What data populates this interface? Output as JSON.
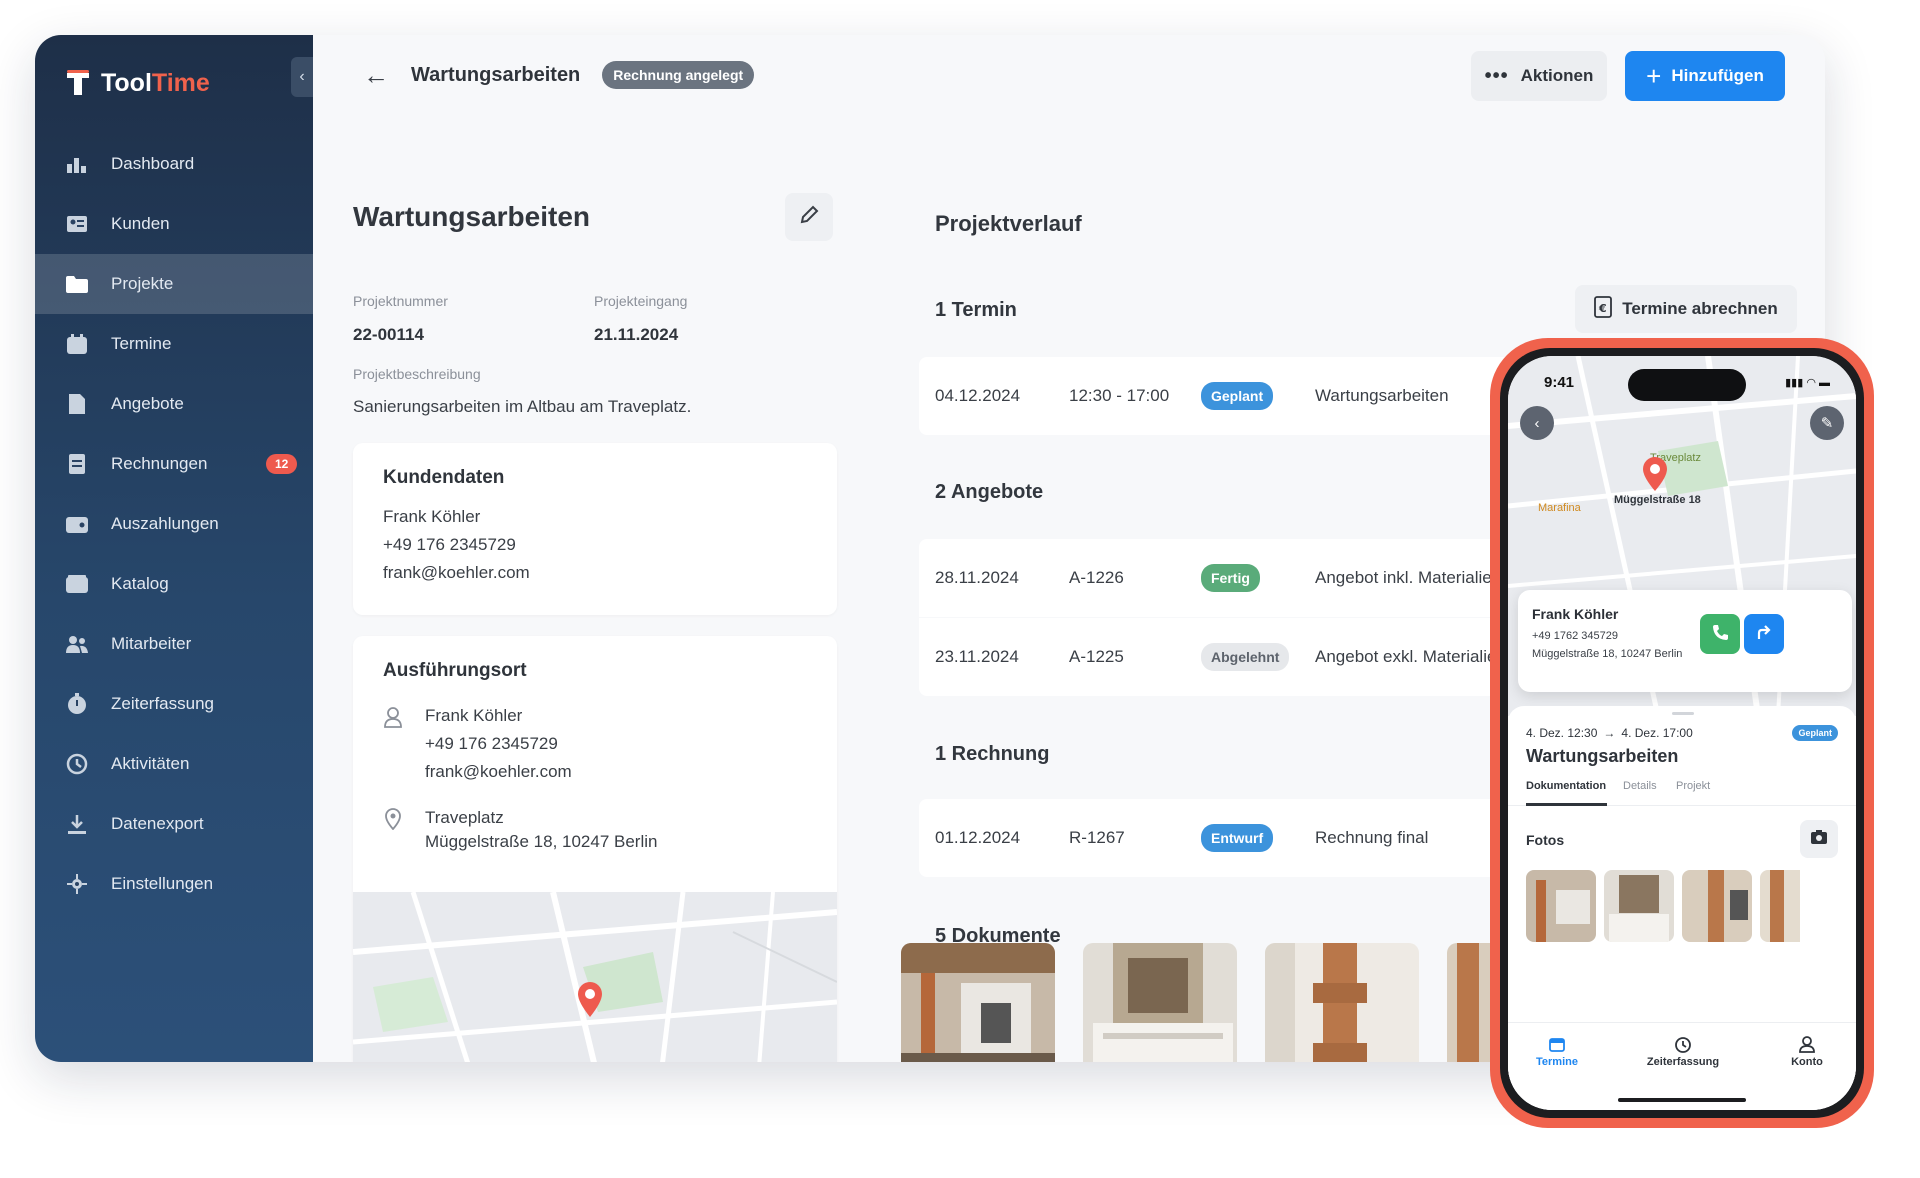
{
  "brand": {
    "name_part1": "Tool",
    "name_part2": "Time",
    "accent_color": "#f0624c"
  },
  "sidebar": {
    "items": [
      {
        "label": "Dashboard",
        "icon": "dashboard-icon"
      },
      {
        "label": "Kunden",
        "icon": "customers-icon"
      },
      {
        "label": "Projekte",
        "icon": "folder-icon",
        "active": true
      },
      {
        "label": "Termine",
        "icon": "calendar-icon"
      },
      {
        "label": "Angebote",
        "icon": "document-icon"
      },
      {
        "label": "Rechnungen",
        "icon": "invoice-icon",
        "badge": "12"
      },
      {
        "label": "Auszahlungen",
        "icon": "wallet-icon"
      },
      {
        "label": "Katalog",
        "icon": "catalog-icon"
      },
      {
        "label": "Mitarbeiter",
        "icon": "employees-icon"
      },
      {
        "label": "Zeiterfassung",
        "icon": "stopwatch-icon"
      },
      {
        "label": "Aktivitäten",
        "icon": "history-icon"
      },
      {
        "label": "Datenexport",
        "icon": "download-icon"
      },
      {
        "label": "Einstellungen",
        "icon": "settings-icon"
      }
    ]
  },
  "topbar": {
    "title": "Wartungsarbeiten",
    "status": "Rechnung angelegt",
    "actions_label": "Aktionen",
    "add_label": "Hinzufügen"
  },
  "project": {
    "title": "Wartungsarbeiten",
    "number_label": "Projektnummer",
    "number": "22-00114",
    "received_label": "Projekteingang",
    "received": "21.11.2024",
    "description_label": "Projektbeschreibung",
    "description": "Sanierungsarbeiten im Altbau am Traveplatz."
  },
  "customer": {
    "heading": "Kundendaten",
    "name": "Frank Köhler",
    "phone": "+49 176 2345729",
    "email": "frank@koehler.com"
  },
  "location": {
    "heading": "Ausführungsort",
    "name": "Frank Köhler",
    "phone": "+49 176 2345729",
    "email": "frank@koehler.com",
    "place": "Traveplatz",
    "address": "Müggelstraße 18, 10247 Berlin"
  },
  "history": {
    "heading": "Projektverlauf",
    "appointments_heading": "1 Termin",
    "bill_button": "Termine abrechnen",
    "appointments": [
      {
        "date": "04.12.2024",
        "time": "12:30 - 17:00",
        "status": "Geplant",
        "title": "Wartungsarbeiten"
      }
    ],
    "offers_heading": "2 Angebote",
    "offers": [
      {
        "date": "28.11.2024",
        "number": "A-1226",
        "status": "Fertig",
        "title": "Angebot inkl. Materialien"
      },
      {
        "date": "23.11.2024",
        "number": "A-1225",
        "status": "Abgelehnt",
        "title": "Angebot exkl. Materialien"
      }
    ],
    "invoices_heading": "1 Rechnung",
    "invoices": [
      {
        "date": "01.12.2024",
        "number": "R-1267",
        "status": "Entwurf",
        "title": "Rechnung final"
      }
    ],
    "documents_heading": "5 Dokumente"
  },
  "phone": {
    "time": "9:41",
    "map_labels": {
      "place": "Traveplatz",
      "street": "Müggelstraße 18",
      "poi": "Marafina"
    },
    "contact_name": "Frank Köhler",
    "contact_phone": "+49 1762 345729",
    "contact_address": "Müggelstraße 18, 10247 Berlin",
    "range_start": "4. Dez. 12:30",
    "range_arrow": "→",
    "range_end": "4. Dez. 17:00",
    "status": "Geplant",
    "title": "Wartungsarbeiten",
    "tabs": [
      "Dokumentation",
      "Details",
      "Projekt"
    ],
    "photos_heading": "Fotos",
    "tabbar": [
      "Termine",
      "Zeiterfassung",
      "Konto"
    ]
  }
}
